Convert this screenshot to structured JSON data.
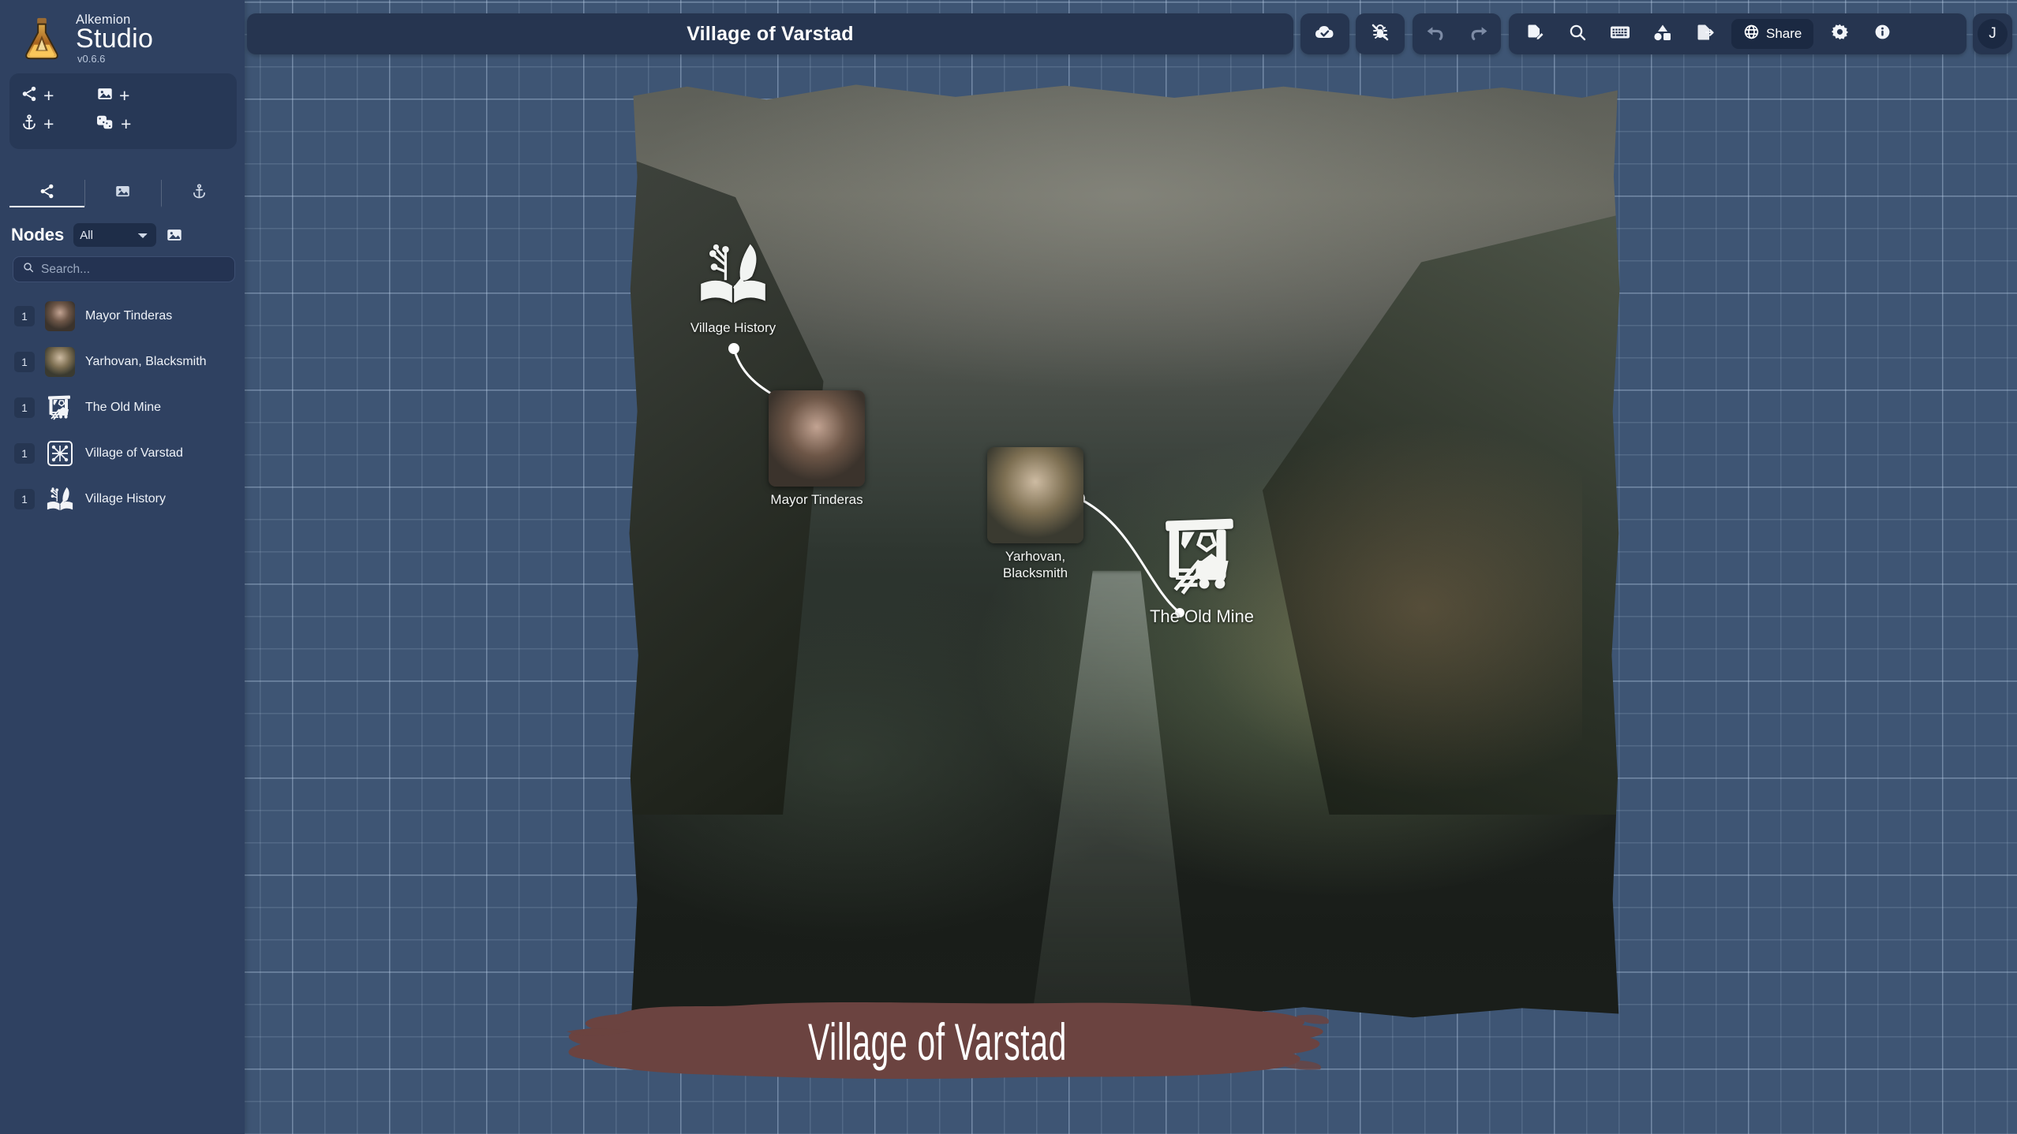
{
  "app": {
    "brand_top": "Alkemion",
    "brand_main": "Studio",
    "version": "v0.6.6",
    "logo_icon": "alchemy-flask-icon"
  },
  "colors": {
    "canvas_background": "#3e5574",
    "grid_line": "#becfe6",
    "panel": "#2f4161",
    "panel_dark": "#263550",
    "input": "#243352",
    "banner_brush": "#6b4340",
    "accent_text": "#ffffff"
  },
  "sidebar": {
    "quick_add": [
      {
        "icon": "share-nodes-icon",
        "plus": "+",
        "name": "add-node"
      },
      {
        "icon": "image-icon",
        "plus": "+",
        "name": "add-image"
      },
      {
        "icon": "anchor-icon",
        "plus": "+",
        "name": "add-anchor"
      },
      {
        "icon": "dice-icon",
        "plus": "+",
        "name": "add-dice"
      }
    ],
    "tabs": [
      {
        "icon": "share-nodes-icon",
        "name": "tab-nodes",
        "active": true
      },
      {
        "icon": "image-icon",
        "name": "tab-images",
        "active": false
      },
      {
        "icon": "anchor-icon",
        "name": "tab-anchors",
        "active": false
      }
    ],
    "nodes_title": "Nodes",
    "filter_value": "All",
    "filter_options": [
      "All"
    ],
    "gallery_icon": "image-icon",
    "search_placeholder": "Search...",
    "search_value": "",
    "search_icon": "search-icon",
    "items": [
      {
        "count": "1",
        "label": "Mayor Tinderas",
        "icon": "portrait-mayor"
      },
      {
        "count": "1",
        "label": "Yarhovan, Blacksmith",
        "icon": "portrait-blacksmith"
      },
      {
        "count": "1",
        "label": "The Old Mine",
        "icon": "mine-icon"
      },
      {
        "count": "1",
        "label": "Village of Varstad",
        "icon": "graph-square-icon"
      },
      {
        "count": "1",
        "label": "Village History",
        "icon": "book-quill-icon"
      }
    ]
  },
  "titlebar": {
    "document_title": "Village of Varstad",
    "groups": {
      "cloud": [
        {
          "icon": "cloud-check-icon",
          "name": "save-status-button",
          "dim": false
        }
      ],
      "debug": [
        {
          "icon": "bug-off-icon",
          "name": "debug-toggle-button",
          "dim": false
        }
      ],
      "history": [
        {
          "icon": "undo-icon",
          "name": "undo-button",
          "dim": true
        },
        {
          "icon": "redo-icon",
          "name": "redo-button",
          "dim": true
        }
      ],
      "main": [
        {
          "icon": "file-edit-icon",
          "name": "edit-document-button",
          "dim": false
        },
        {
          "icon": "search-icon",
          "name": "search-button",
          "dim": false
        },
        {
          "icon": "keyboard-icon",
          "name": "keyboard-shortcuts-button",
          "dim": false
        },
        {
          "icon": "shapes-icon",
          "name": "shapes-button",
          "dim": false
        },
        {
          "icon": "export-icon",
          "name": "export-button",
          "dim": false
        }
      ],
      "share_label": "Share",
      "share_icon": "globe-icon",
      "trailing": [
        {
          "icon": "gear-icon",
          "name": "settings-button",
          "dim": false
        },
        {
          "icon": "info-icon",
          "name": "info-button",
          "dim": false
        }
      ]
    },
    "avatar_initial": "J"
  },
  "canvas": {
    "map_nodes": [
      {
        "name": "map-node-village-history",
        "label": "Village History",
        "icon": "book-quill-icon"
      },
      {
        "name": "map-node-mayor-tinderas",
        "label": "Mayor Tinderas",
        "icon": "portrait-mayor"
      },
      {
        "name": "map-node-yarhovan",
        "label": "Yarhovan,\nBlacksmith",
        "icon": "portrait-blacksmith"
      },
      {
        "name": "map-node-old-mine",
        "label": "The Old Mine",
        "icon": "mine-icon"
      }
    ],
    "banner_title": "Village of Varstad"
  }
}
